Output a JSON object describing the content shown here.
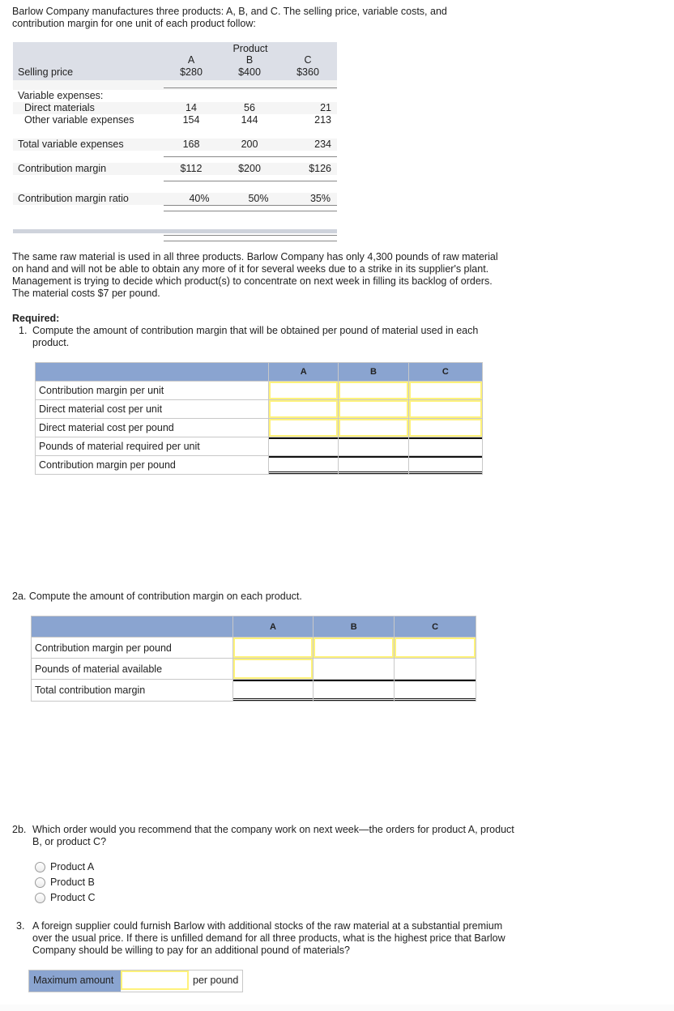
{
  "intro": "Barlow Company manufactures three products: A, B, and C. The selling price, variable costs, and contribution margin for one unit of each product follow:",
  "product_table": {
    "header_group": "Product",
    "columns": [
      "A",
      "B",
      "C"
    ],
    "selling_price": {
      "label": "Selling price",
      "values": [
        "$280",
        "$400",
        "$360"
      ]
    },
    "variable_header": "Variable expenses:",
    "direct_materials": {
      "label": "Direct materials",
      "values": [
        "14",
        "56",
        "21"
      ]
    },
    "other_variable": {
      "label": "Other variable expenses",
      "values": [
        "154",
        "144",
        "213"
      ]
    },
    "total_variable": {
      "label": "Total variable expenses",
      "values": [
        "168",
        "200",
        "234"
      ]
    },
    "contribution_margin": {
      "label": "Contribution margin",
      "values": [
        "$112",
        "$200",
        "$126"
      ]
    },
    "cm_ratio": {
      "label": "Contribution margin ratio",
      "values": [
        "40%",
        "50%",
        "35%"
      ]
    }
  },
  "paragraph": "The same raw material is used in all three products. Barlow Company has only 4,300 pounds of raw material on hand and will not be able to obtain any more of it for several weeks due to a strike in its supplier's plant. Management is trying to decide which product(s) to concentrate on next week in filling its backlog of orders. The material costs $7 per pound.",
  "required_label": "Required:",
  "q1": {
    "number": "1.",
    "text": "Compute the amount of contribution margin that will be obtained per pound of material used in each product.",
    "columns": [
      "A",
      "B",
      "C"
    ],
    "rows": [
      {
        "label": "Contribution margin per unit",
        "values": [
          "",
          "",
          ""
        ]
      },
      {
        "label": "Direct material cost per unit",
        "values": [
          "",
          "",
          ""
        ]
      },
      {
        "label": "Direct material cost per pound",
        "values": [
          "",
          "",
          ""
        ]
      },
      {
        "label": "Pounds of material required per unit",
        "values": [
          "",
          "",
          ""
        ]
      },
      {
        "label": "Contribution margin per pound",
        "values": [
          "",
          "",
          ""
        ]
      }
    ]
  },
  "q2a": {
    "text": "2a. Compute the amount of contribution margin on each product.",
    "columns": [
      "A",
      "B",
      "C"
    ],
    "rows": [
      {
        "label": "Contribution margin per pound",
        "values": [
          "",
          "",
          ""
        ]
      },
      {
        "label": "Pounds of material available",
        "values": [
          "",
          "",
          ""
        ]
      },
      {
        "label": "Total contribution margin",
        "values": [
          "",
          "",
          ""
        ]
      }
    ]
  },
  "q2b": {
    "number": "2b.",
    "text": "Which order would you recommend that the company work on next week—the orders for product A, product B, or product C?",
    "options": [
      "Product A",
      "Product B",
      "Product C"
    ],
    "selected": null
  },
  "q3": {
    "number": "3.",
    "text": "A foreign supplier could furnish Barlow with additional stocks of the raw material at a substantial premium over the usual price. If there is unfilled demand for all three products, what is the highest price that Barlow Company should be willing to pay for an additional pound of materials?",
    "label": "Maximum amount",
    "value": "",
    "unit": "per pound"
  }
}
